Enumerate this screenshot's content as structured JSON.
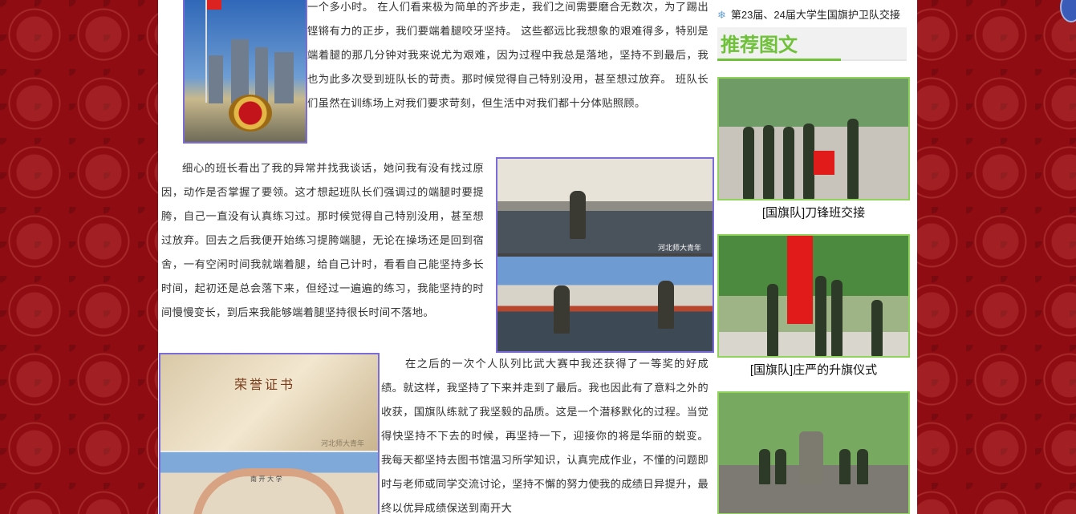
{
  "article": {
    "para1": "一个多小时。 在人们看来极为简单的齐步走，我们之间需要磨合无数次，为了踢出铿锵有力的正步，我们要端着腿咬牙坚持。 这些都远比我想象的艰难得多，特别是端着腿的那几分钟对我来说尤为艰难，因为过程中我总是落地，坚持不到最后，我也为此多次受到班队长的苛责。那时候觉得自己特别没用，甚至想过放弃。 班队长们虽然在训练场上对我们要求苛刻，但生活中对我们都十分体贴照顾。",
    "para2": "细心的班长看出了我的异常并找我谈话，她问我有没有找过原因，动作是否掌握了要领。这才想起班队长们强调过的端腿时要提胯，自己一直没有认真练习过。那时候觉得自己特别没用，甚至想过放弃。回去之后我便开始练习提胯端腿，无论在操场还是回到宿舍，一有空闲时间我就端着腿，给自己计时，看看自己能坚持多长时间，起初还是总会落下来，但经过一遍遍的练习，我能坚持的时间慢慢变长，到后来我能够端着腿坚持很长时间不落地。",
    "para3": "在之后的一次个人队列比武大赛中我还获得了一等奖的好成绩。就这样，我坚持了下来并走到了最后。我也因此有了意料之外的收获，国旗队练就了我坚毅的品质。这是一个潜移默化的过程。当觉得快坚持不下去的时候，再坚持一下，迎接你的将是华丽的蜕变。 我每天都坚持去图书馆温习所学知识，认真完成作业，不懂的问题即时与老师或同学交流讨论，坚持不懈的努力使我的成绩日异提升，最终以优异成绩保送到南开大",
    "photo2_watermark": "河北师大青年",
    "photo3_cert_title": "荣誉证书",
    "photo3_campus_label": "南 开 大 学",
    "photo3_watermark": "河北师大青年"
  },
  "sidebar": {
    "top_link": "第23届、24届大学生国旗护卫队交接",
    "section_title": "推荐图文",
    "cards": [
      {
        "caption": "[国旗队]刀锋班交接"
      },
      {
        "caption": "[国旗队]庄严的升旗仪式"
      },
      {
        "caption": ""
      }
    ]
  },
  "colors": {
    "page_background": "#8e0c12",
    "accent_green": "#6fc13a",
    "photo_border": "#7b6cd9",
    "card_border": "#8fd35c"
  }
}
